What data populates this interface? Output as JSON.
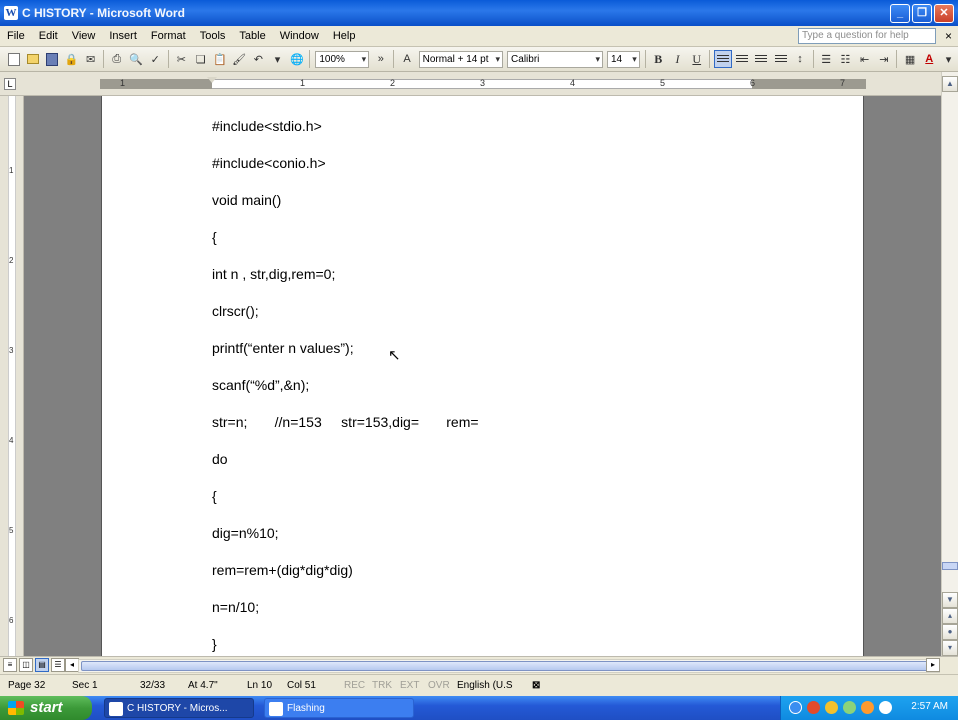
{
  "window": {
    "title": "C  HISTORY - Microsoft Word"
  },
  "menu": [
    "File",
    "Edit",
    "View",
    "Insert",
    "Format",
    "Tools",
    "Table",
    "Window",
    "Help"
  ],
  "help_placeholder": "Type a question for help",
  "toolbar": {
    "zoom": "100%",
    "style": "Normal + 14 pt",
    "font": "Calibri",
    "size": "14",
    "bold": "B",
    "italic": "I",
    "underline": "U"
  },
  "ruler_numbers": [
    "1",
    "1",
    "2",
    "3",
    "4",
    "5",
    "6",
    "7"
  ],
  "vruler_numbers": [
    "1",
    "2",
    "3",
    "4",
    "5",
    "6"
  ],
  "code_lines": [
    "#include<stdio.h>",
    "#include<conio.h>",
    "void main()",
    "{",
    "int n , str,dig,rem=0;",
    "clrscr();",
    "printf(“enter n values”);",
    "scanf(“%d”,&n);",
    "str=n;       //n=153     str=153,dig=       rem=",
    "do",
    "{",
    "dig=n%10;",
    "rem=rem+(dig*dig*dig)",
    "n=n/10;",
    "}"
  ],
  "status": {
    "page": "Page 32",
    "sec": "Sec 1",
    "pages": "32/33",
    "at": "At 4.7\"",
    "ln": "Ln 10",
    "col": "Col 51",
    "rec": "REC",
    "trk": "TRK",
    "ext": "EXT",
    "ovr": "OVR",
    "lang": "English (U.S"
  },
  "taskbar": {
    "start": "start",
    "tasks": [
      "C  HISTORY - Micros...",
      "Flashing"
    ],
    "clock": "2:57 AM"
  }
}
